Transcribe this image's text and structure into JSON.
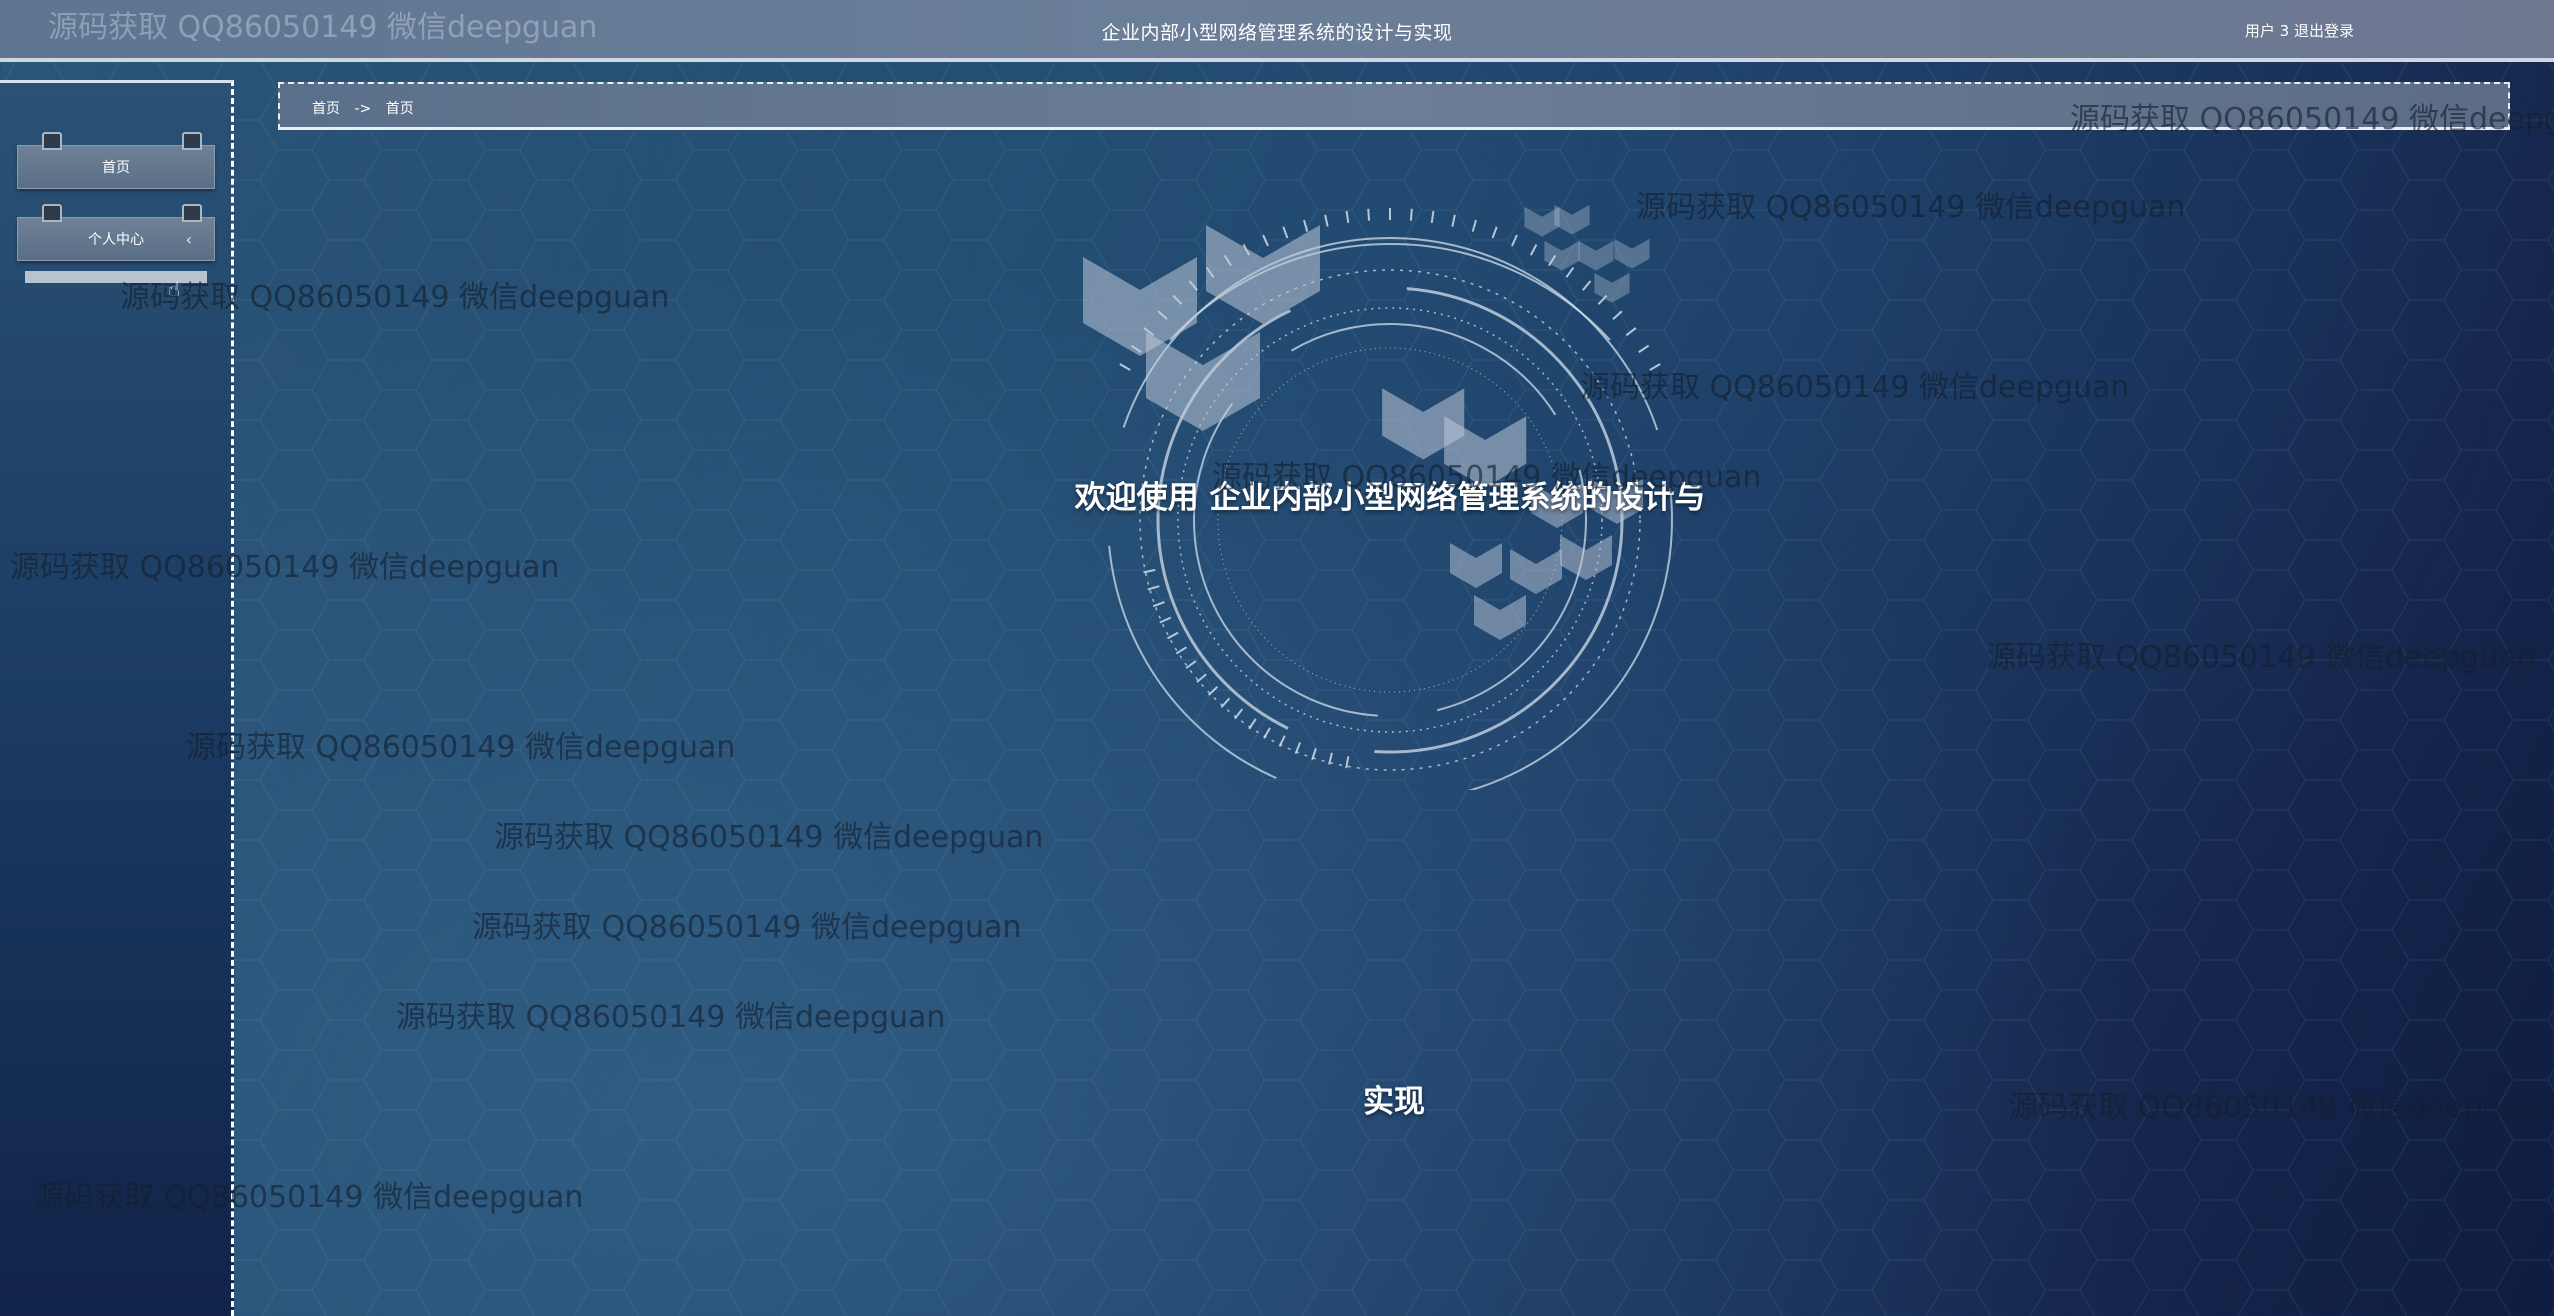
{
  "header": {
    "title": "企业内部小型网络管理系统的设计与实现",
    "user_label": "用户 3",
    "logout_label": "退出登录"
  },
  "sidebar": {
    "items": [
      {
        "label": "首页"
      },
      {
        "label": "个人中心",
        "chevron": "‹"
      }
    ]
  },
  "breadcrumb": {
    "home": "首页",
    "separator": "->",
    "current": "首页"
  },
  "main": {
    "welcome_line1": "欢迎使用 企业内部小型网络管理系统的设计与",
    "welcome_line2": "实现"
  },
  "watermark": {
    "text": "源码获取 QQ86050149 微信deepguan"
  },
  "colors": {
    "topbar": "#6a7e98",
    "background_dark": "#101c40",
    "background_light": "#2b5679",
    "sidebar_border": "#ffffff",
    "text": "#ffffff"
  },
  "icons": {
    "cursor": "hand-pointer-icon",
    "chevron": "chevron-left-icon"
  }
}
